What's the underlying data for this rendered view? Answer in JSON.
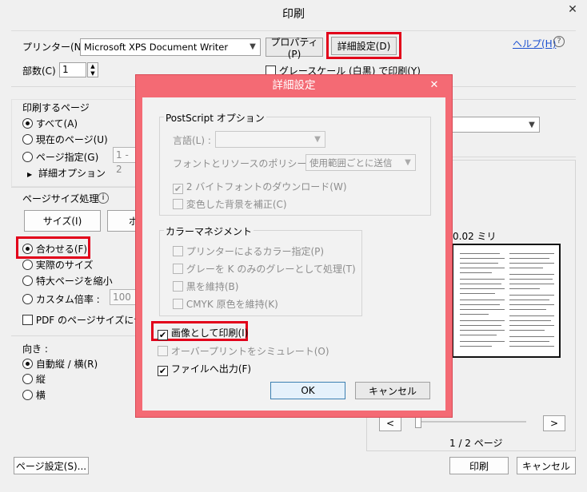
{
  "window": {
    "title": "印刷",
    "close": "✕"
  },
  "printer": {
    "label": "プリンター(N) :",
    "value": "Microsoft XPS Document Writer",
    "properties": "プロパティ(P)",
    "advanced": "詳細設定(D)",
    "help": "ヘルプ(H)",
    "copies_label": "部数(C) :",
    "copies_value": "1",
    "grayscale": "グレースケール (白黒) で印刷(Y)"
  },
  "pages": {
    "title": "印刷するページ",
    "all": "すべて(A)",
    "current": "現在のページ(U)",
    "range": "ページ指定(G)",
    "range_value": "1 - 2",
    "more": "詳細オプション"
  },
  "sizing": {
    "title": "ページサイズ処理",
    "size_btn": "サイズ(I)",
    "poster_btn": "ポ",
    "fit": "合わせる(F)",
    "actual": "実際のサイズ",
    "shrink": "特大ページを縮小",
    "custom": "カスタム倍率 :",
    "custom_value": "100",
    "pdf_size": "PDF のページサイズに合わ"
  },
  "orientation": {
    "title": "向き :",
    "auto": "自動縦 / 横(R)",
    "portrait": "縦",
    "landscape": "横"
  },
  "preview": {
    "size_text": "0.02 ミリ",
    "page_count": "1 / 2 ページ",
    "prev": "<",
    "next": ">"
  },
  "footer": {
    "page_setup": "ページ設定(S)...",
    "print": "印刷",
    "cancel": "キャンセル"
  },
  "modal": {
    "title": "詳細設定",
    "close": "✕",
    "postscript_group": "PostScript オプション",
    "language": "言語(L) :",
    "font_policy": "フォントとリソースのポリシー(N) :",
    "font_policy_value": "使用範囲ごとに送信",
    "dl_2byte": "2 バイトフォントのダウンロード(W)",
    "fix_bg": "変色した背景を補正(C)",
    "color_group": "カラーマネジメント",
    "printer_color": "プリンターによるカラー指定(P)",
    "gray_k": "グレーを K のみのグレーとして処理(T)",
    "keep_black": "黒を維持(B)",
    "cmyk": "CMYK 原色を維持(K)",
    "as_image": "画像として印刷(I)",
    "overprint": "オーバープリントをシミュレート(O)",
    "to_file": "ファイルへ出力(F)",
    "ok": "OK",
    "cancel": "キャンセル"
  },
  "colors": {
    "highlight": "#e2001a",
    "modal_frame": "#f46a74",
    "link": "#1a4fd0"
  }
}
